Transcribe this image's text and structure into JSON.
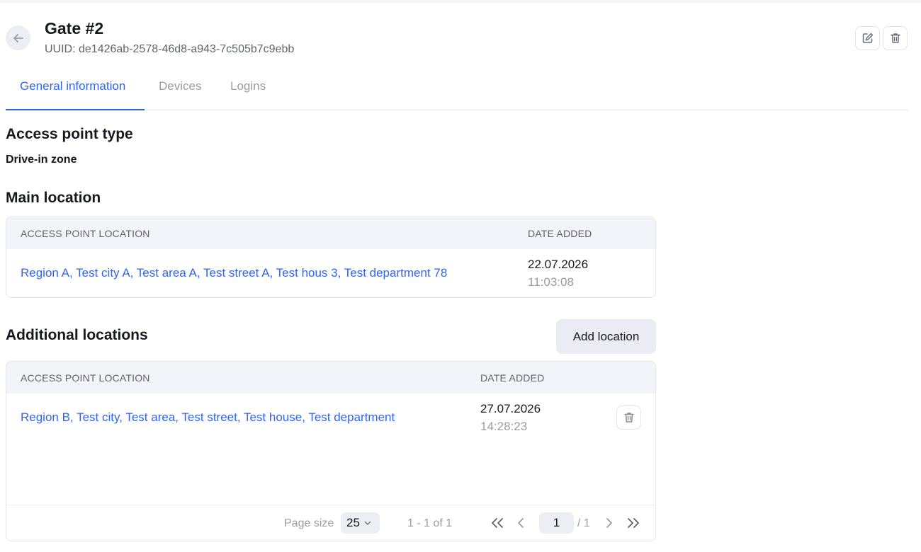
{
  "header": {
    "title": "Gate #2",
    "uuid": "UUID: de1426ab-2578-46d8-a943-7c505b7c9ebb"
  },
  "tabs": [
    {
      "label": "General information",
      "active": true
    },
    {
      "label": "Devices",
      "active": false
    },
    {
      "label": "Logins",
      "active": false
    }
  ],
  "access_point_type": {
    "heading": "Access point type",
    "value": "Drive-in zone"
  },
  "main_location": {
    "heading": "Main location",
    "col_location": "ACCESS POINT LOCATION",
    "col_date": "DATE ADDED",
    "rows": [
      {
        "location": "Region A, Test city A, Test area A, Test street A, Test hous 3, Test department 78",
        "date": "22.07.2026",
        "time": "11:03:08"
      }
    ]
  },
  "additional_locations": {
    "heading": "Additional locations",
    "add_button": "Add location",
    "col_location": "ACCESS POINT LOCATION",
    "col_date": "DATE ADDED",
    "rows": [
      {
        "location": "Region B, Test city, Test area, Test street, Test house, Test department",
        "date": "27.07.2026",
        "time": "14:28:23"
      }
    ]
  },
  "pagination": {
    "page_size_label": "Page size",
    "page_size": "25",
    "range": "1 - 1 of 1",
    "current_page": "1",
    "total_pages": "/ 1"
  },
  "colors": {
    "accent": "#3466e0",
    "muted": "#9a9ca3",
    "header_bg": "#f3f4fa"
  },
  "icons": [
    "arrow-left-icon",
    "edit-icon",
    "trash-icon",
    "chevron-down-icon",
    "chevrons-left-icon",
    "chevron-left-icon",
    "chevron-right-icon",
    "chevrons-right-icon"
  ]
}
